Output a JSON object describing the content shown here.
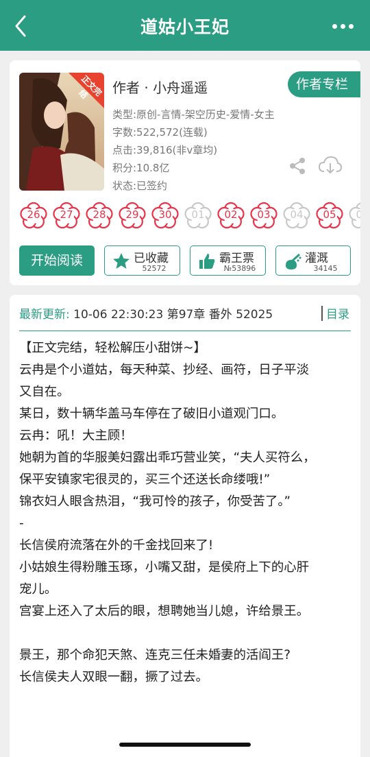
{
  "header": {
    "title": "道姑小王妃"
  },
  "book": {
    "cover_badge": "正文完结",
    "author_line": "作者 · 小舟遥遥",
    "author_button": "作者专栏",
    "genre": "类型:原创-言情-架空历史-爱情-女主",
    "word_count": "字数:522,572(连载)",
    "clicks": "点击:39,816(非v章均)",
    "points": "积分:10.8亿",
    "status": "状态:已签约"
  },
  "flowers": [
    {
      "label": "26",
      "active": true
    },
    {
      "label": "27",
      "active": true
    },
    {
      "label": "28",
      "active": true
    },
    {
      "label": "29",
      "active": true
    },
    {
      "label": "30",
      "active": true
    },
    {
      "label": "01",
      "active": false
    },
    {
      "label": "02",
      "active": true
    },
    {
      "label": "03",
      "active": true
    },
    {
      "label": "04",
      "active": false
    },
    {
      "label": "05",
      "active": true
    },
    {
      "label": "06",
      "active": false
    }
  ],
  "actions": {
    "read_label": "开始阅读",
    "collect_label": "已收藏",
    "collect_count": "52572",
    "ticket_label": "霸王票",
    "ticket_count": "№53896",
    "water_label": "灌溉",
    "water_count": "34145"
  },
  "update": {
    "label": "最新更新:",
    "value": "10-06 22:30:23  第97章 番外 52025",
    "toc_label": "目录"
  },
  "description": [
    "【正文完结，轻松解压小甜饼~】",
    "云冉是个小道姑，每天种菜、抄经、画符，日子平淡",
    "又自在。",
    "某日，数十辆华盖马车停在了破旧小道观门口。",
    "云冉：吼！大主顾！",
    "她朝为首的华服美妇露出乖巧营业笑，“夫人买符么，",
    "保平安镇家宅很灵的，买三个还送长命缕哦!”",
    "锦衣妇人眼含热泪，“我可怜的孩子，你受苦了。”",
    "-",
    "长信侯府流落在外的千金找回来了!",
    "小姑娘生得粉雕玉琢，小嘴又甜，是侯府上下的心肝",
    "宠儿。",
    "宫宴上还入了太后的眼，想聘她当儿媳，许给景王。",
    "",
    "景王，那个命犯天煞、连克三任未婚妻的活阎王?",
    "长信侯夫人双眼一翻，撅了过去。"
  ],
  "colors": {
    "accent": "#2a9d83",
    "flower_active": "#e8334a",
    "flower_inactive": "#c8c8c8"
  }
}
